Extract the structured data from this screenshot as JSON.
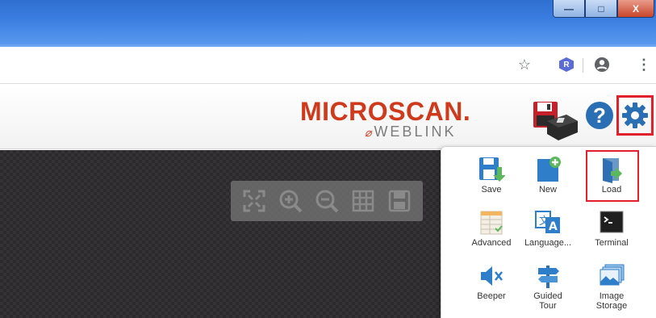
{
  "window": {
    "buttons": {
      "minimize": "—",
      "maximize": "□",
      "close": "X"
    }
  },
  "browser": {
    "icons": [
      "star-icon",
      "extension-icon",
      "account-icon",
      "menu-icon"
    ],
    "extension_letter": "R",
    "menu_glyph": "⋮"
  },
  "header": {
    "logo_main": "MICROSCAN.",
    "logo_sub": "WEBLINK",
    "logo_mark": "⌀",
    "help_label": "?",
    "colors": {
      "brand": "#cf3a1c",
      "accent": "#2a6fb3",
      "highlight": "#e0202a"
    }
  },
  "zoombar": {
    "icons": [
      "fit-icon",
      "zoom-in-icon",
      "zoom-out-icon",
      "grid-icon",
      "save-image-icon"
    ]
  },
  "menu_panel": {
    "items": [
      {
        "label": "Save",
        "icon": "save-icon"
      },
      {
        "label": "New",
        "icon": "new-icon"
      },
      {
        "label": "Load",
        "icon": "load-icon"
      },
      {
        "label": "Advanced",
        "icon": "advanced-icon"
      },
      {
        "label": "Language...",
        "icon": "language-icon"
      },
      {
        "label": "Terminal",
        "icon": "terminal-icon"
      },
      {
        "label": "Beeper",
        "icon": "beeper-icon"
      },
      {
        "label": "Guided Tour",
        "icon": "guided-tour-icon"
      },
      {
        "label": "Image Storage",
        "icon": "image-storage-icon"
      }
    ]
  }
}
